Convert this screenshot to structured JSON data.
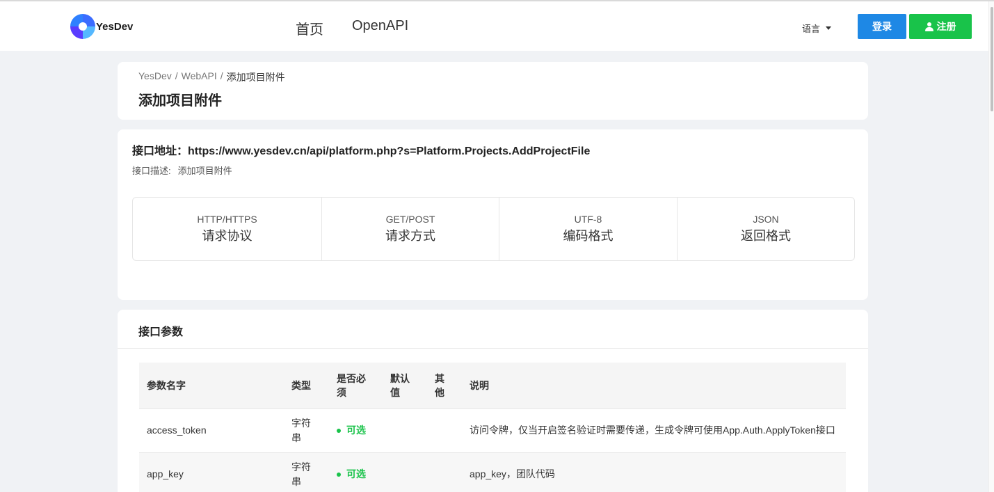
{
  "header": {
    "logo_text": "YesDev",
    "nav": [
      "首页",
      "OpenAPI"
    ],
    "language_label": "语言",
    "login_label": "登录",
    "register_label": "注册"
  },
  "breadcrumb": [
    "YesDev",
    "WebAPI",
    "添加项目附件"
  ],
  "page_title": "添加项目附件",
  "api": {
    "url_label": "接口地址：",
    "url": "https://www.yesdev.cn/api/platform.php?s=Platform.Projects.AddProjectFile",
    "desc_label": "接口描述:",
    "desc": "添加项目附件",
    "info": [
      {
        "value": "HTTP/HTTPS",
        "label": "请求协议"
      },
      {
        "value": "GET/POST",
        "label": "请求方式"
      },
      {
        "value": "UTF-8",
        "label": "编码格式"
      },
      {
        "value": "JSON",
        "label": "返回格式"
      }
    ]
  },
  "params": {
    "title": "接口参数",
    "columns": [
      "参数名字",
      "类型",
      "是否必须",
      "默认值",
      "其他",
      "说明"
    ],
    "rows": [
      {
        "name": "access_token",
        "type": "字符串",
        "required": "可选",
        "default": "",
        "other": "",
        "desc": "访问令牌，仅当开启签名验证时需要传递，生成令牌可使用App.Auth.ApplyToken接口"
      },
      {
        "name": "app_key",
        "type": "字符串",
        "required": "可选",
        "default": "",
        "other": "",
        "desc": "app_key，团队代码"
      }
    ]
  },
  "colors": {
    "primary": "#1e88e5",
    "success": "#19c34a",
    "background": "#f0f2f5"
  }
}
